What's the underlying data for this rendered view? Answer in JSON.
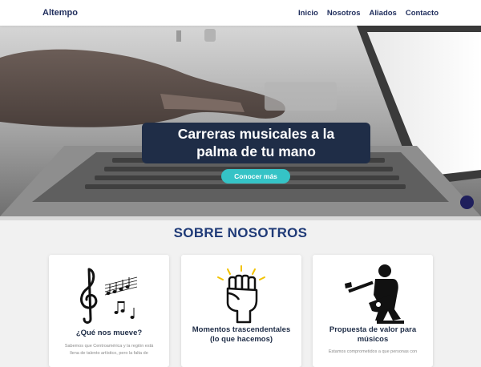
{
  "nav": {
    "brand": "Altempo",
    "links": [
      "Inicio",
      "Nosotros",
      "Aliados",
      "Contacto"
    ]
  },
  "hero": {
    "title_line1": "Carreras musicales a la",
    "title_line2": "palma de tu mano",
    "cta_label": "Conocer más"
  },
  "about": {
    "title": "SOBRE NOSOTROS",
    "cards": [
      {
        "icon": "music-notes-icon",
        "title": "¿Qué nos mueve?",
        "text_line1": "Sabemos que Centroamérica y la región está",
        "text_line2": "llena de talento artístico, pero la falta de"
      },
      {
        "icon": "raised-fist-icon",
        "title": "Momentos trascendentales (lo que hacemos)",
        "text_line1": ""
      },
      {
        "icon": "guitarist-icon",
        "title": "Propuesta de valor para músicos",
        "text_line1": "Estamos comprometidos a que personas con"
      }
    ]
  },
  "colors": {
    "brand_navy": "#1f2d5c",
    "cta_teal": "#35c3c6",
    "hero_box": "#1f2d47"
  }
}
